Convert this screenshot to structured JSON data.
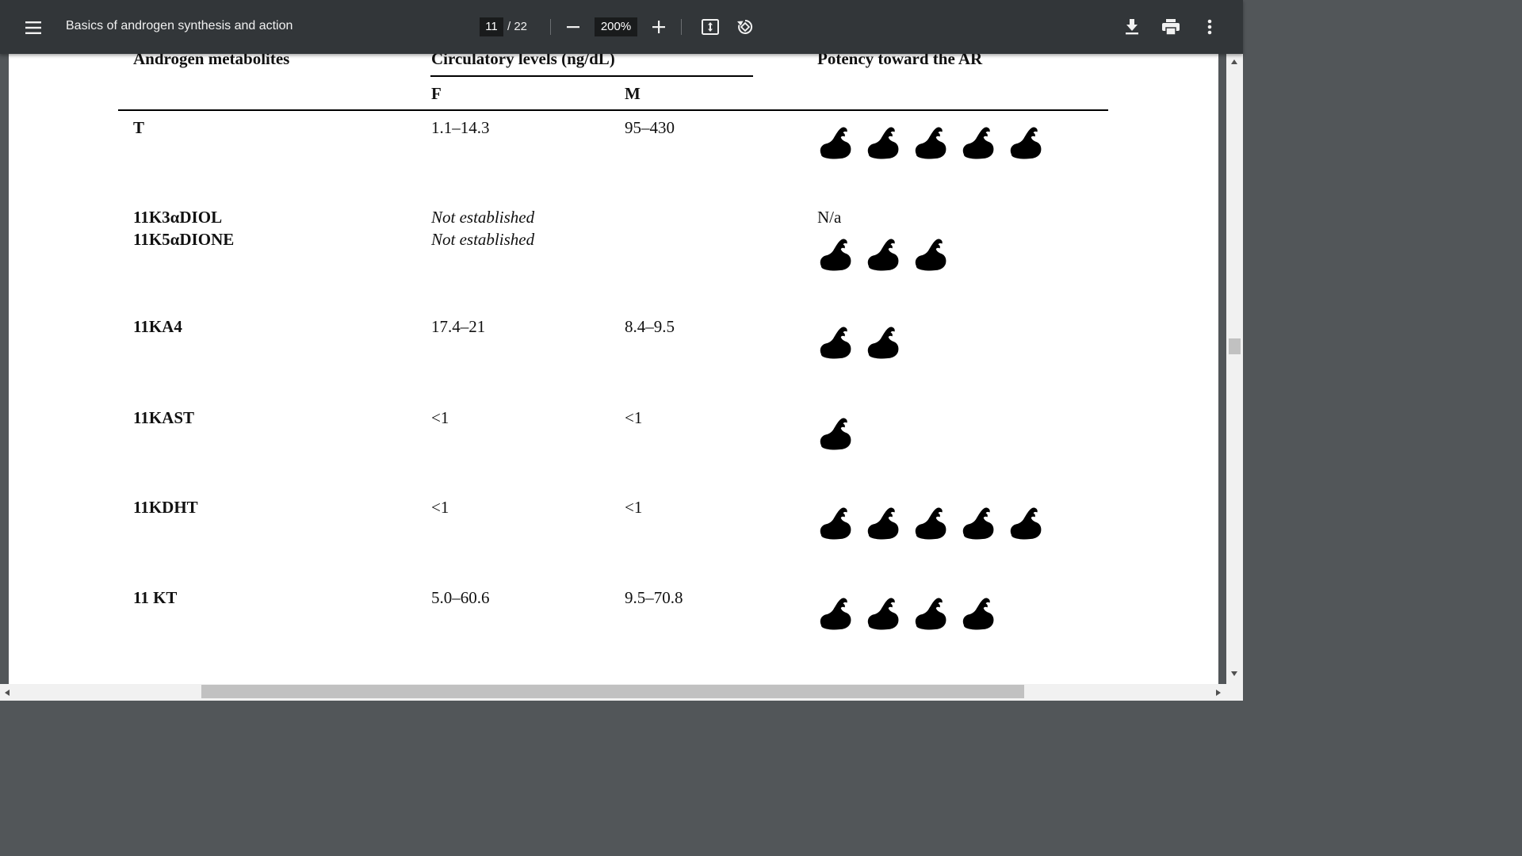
{
  "toolbar": {
    "title": "Basics of androgen synthesis and action",
    "page_current": "11",
    "page_total": "/ 22",
    "zoom": "200%",
    "icons": [
      "menu-icon",
      "zoom-out-icon",
      "zoom-in-icon",
      "fit-page-icon",
      "rotate-icon",
      "download-icon",
      "print-icon",
      "more-icon"
    ]
  },
  "table": {
    "headers": {
      "metabolites": "Androgen metabolites",
      "circulatory": "Circulatory levels (ng/dL)",
      "female": "F",
      "male": "M",
      "potency": "Potency toward the AR"
    },
    "rows": [
      {
        "name": "T",
        "f": "1.1–14.3",
        "m": "95–430",
        "potency": 5
      },
      {
        "name": "11K3αDIOL",
        "name2": "11K5αDIONE",
        "f": "Not established",
        "f2": "Not established",
        "potency_text": "N/a",
        "potency": 3
      },
      {
        "name": "11KA4",
        "f": "17.4–21",
        "m": "8.4–9.5",
        "potency": 2
      },
      {
        "name": "11KAST",
        "f": "<1",
        "m": "<1",
        "potency": 1
      },
      {
        "name": "11KDHT",
        "f": "<1",
        "m": "<1",
        "potency": 5
      },
      {
        "name": "11 KT",
        "f": "5.0–60.6",
        "m": "9.5–70.8",
        "potency": 4
      }
    ]
  },
  "colors": {
    "toolbar": "#323639",
    "background": "#525659",
    "paper": "#ffffff"
  }
}
